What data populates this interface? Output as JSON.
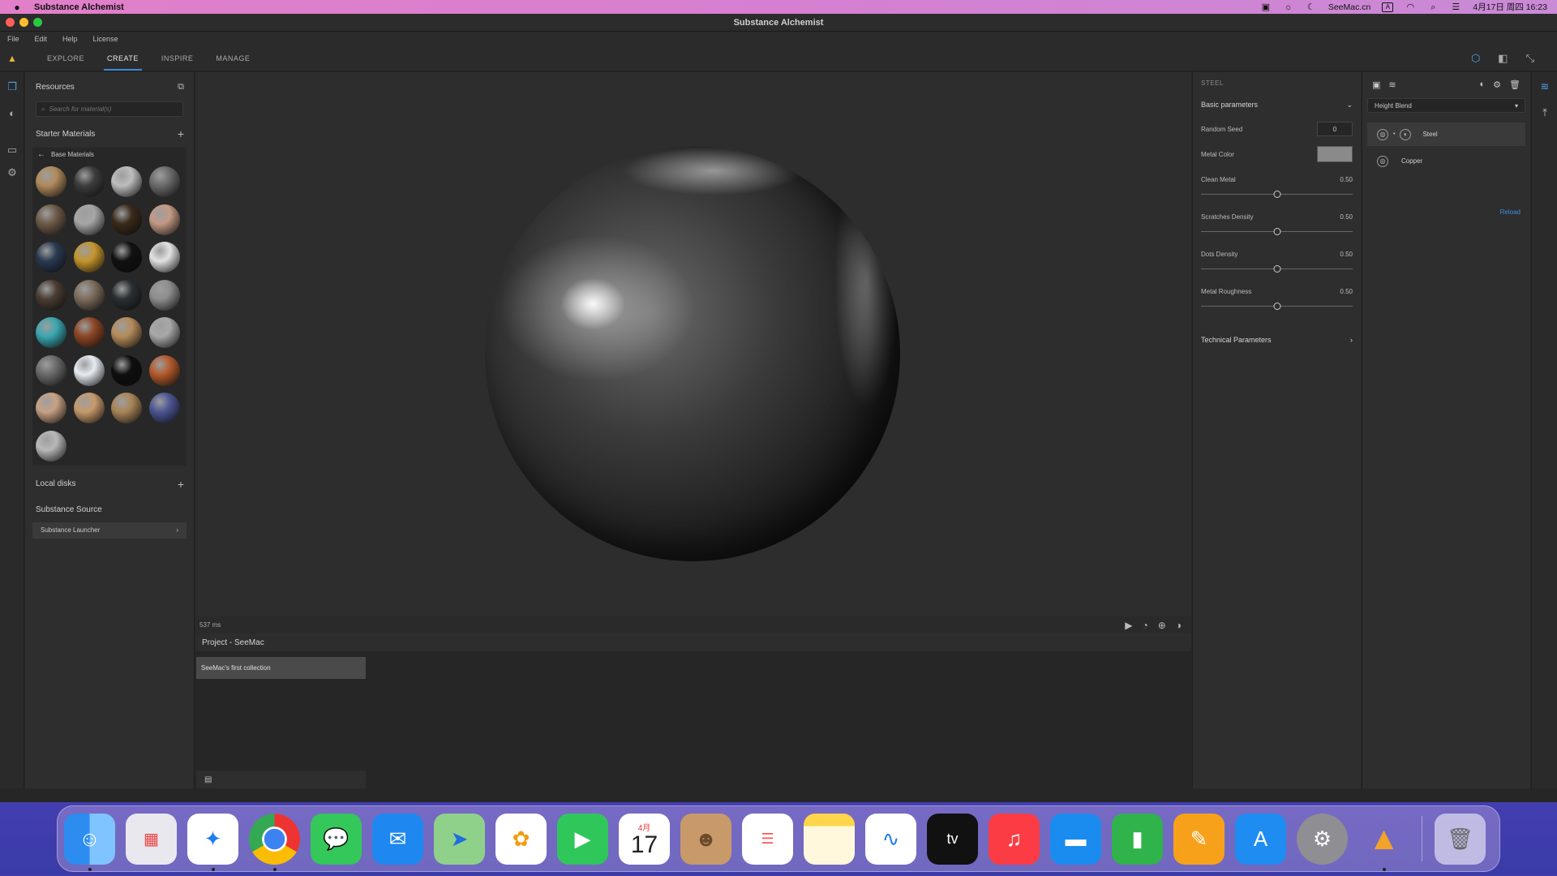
{
  "menubar": {
    "app_name": "Substance Alchemist",
    "site": "SeeMac.cn",
    "input_indicator": "A",
    "datetime": "4月17日 周四 16:23"
  },
  "window": {
    "title": "Substance Alchemist",
    "menu": [
      "File",
      "Edit",
      "Help",
      "License"
    ],
    "tabs": [
      "EXPLORE",
      "CREATE",
      "INSPIRE",
      "MANAGE"
    ],
    "active_tab": "CREATE"
  },
  "resources": {
    "title": "Resources",
    "search_placeholder": "Search for material(s)",
    "starter_title": "Starter Materials",
    "breadcrumb": "Base Materials",
    "local_disks": "Local disks",
    "source_title": "Substance Source",
    "launcher": "Substance Launcher",
    "materials": [
      "#b08a5c",
      "#3d3d3d",
      "#bdbdbd",
      "#6b6b6b",
      "#6d5a48",
      "#a6a6a6",
      "#3a2a1a",
      "#c39a84",
      "#2a3a52",
      "#c4952c",
      "#111111",
      "#e2e2e2",
      "#4a3c33",
      "#7d6c5c",
      "#2a2f33",
      "#8d8d8d",
      "#3aa7b1",
      "#8b4524",
      "#b58b5a",
      "#a8a8a8",
      "#6a6a6a",
      "#e6ecf2",
      "#0e0e0e",
      "#b45a2b",
      "#c7a184",
      "#c79a6c",
      "#a98558",
      "#4c5592",
      "#b8b8b8"
    ]
  },
  "viewport": {
    "timing": "537 ms"
  },
  "project": {
    "title": "Project - SeeMac",
    "collection": "SeeMac's first collection"
  },
  "params": {
    "title": "STEEL",
    "basic_group": "Basic parameters",
    "random_seed_label": "Random Seed",
    "random_seed_value": "0",
    "metal_color_label": "Metal Color",
    "metal_color": "#8a8a8a",
    "sliders": [
      {
        "label": "Clean Metal",
        "value": "0.50",
        "fraction": 0.5
      },
      {
        "label": "Scratches Density",
        "value": "0.50",
        "fraction": 0.5
      },
      {
        "label": "Dots Density",
        "value": "0.50",
        "fraction": 0.5
      },
      {
        "label": "Metal Roughness",
        "value": "0.50",
        "fraction": 0.5
      }
    ],
    "technical_group": "Technical Parameters"
  },
  "layers": {
    "blend_mode": "Height Blend",
    "items": [
      "Steel",
      "Copper"
    ],
    "selected": "Steel",
    "reload": "Reload"
  },
  "dock": {
    "apps": [
      "Finder",
      "Launchpad",
      "Safari",
      "Chrome",
      "Messages",
      "Mail",
      "Maps",
      "Photos",
      "FaceTime",
      "Calendar",
      "Contacts",
      "Reminders",
      "Notes",
      "Freeform",
      "TV",
      "Music",
      "Keynote",
      "Numbers",
      "Pages",
      "App Store",
      "System Settings",
      "Substance Alchemist"
    ],
    "calendar_month": "4月",
    "calendar_day": "17",
    "tv_label": "tv"
  }
}
